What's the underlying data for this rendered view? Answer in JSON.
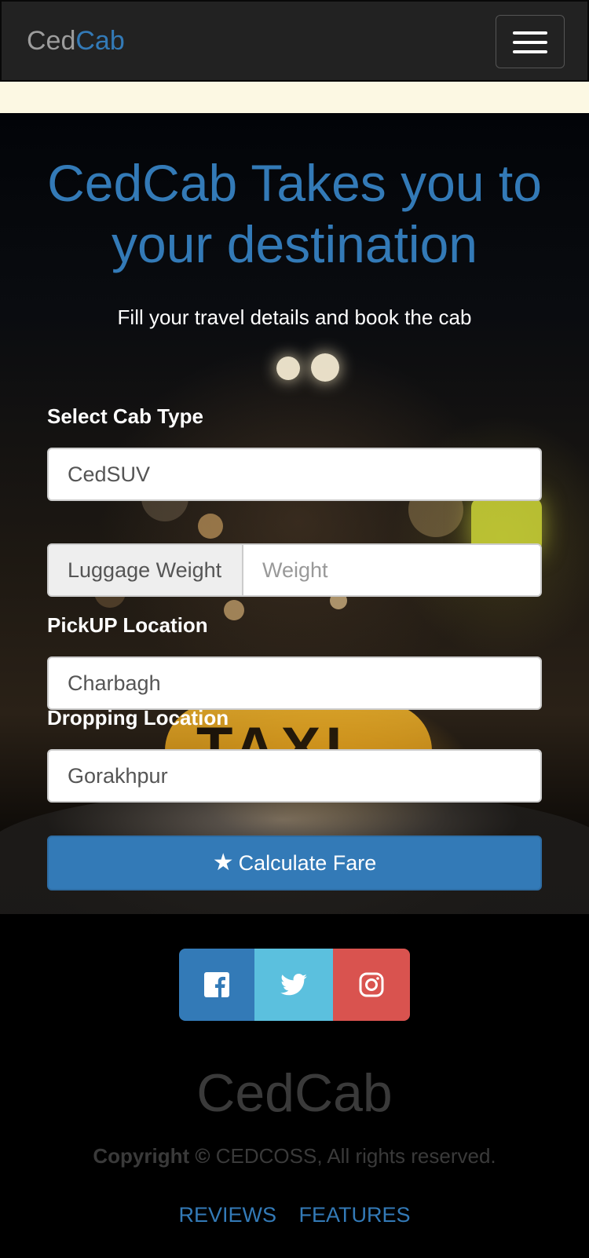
{
  "navbar": {
    "brand_part1": "Ced",
    "brand_part2": "Cab",
    "toggle_icon": "hamburger-menu-icon"
  },
  "hero": {
    "title": "CedCab Takes you to your destination",
    "subtitle": "Fill your travel details and book the cab",
    "sign_text": "TAXI"
  },
  "form": {
    "cab_type_label": "Select Cab Type",
    "cab_type_value": "CedSUV",
    "luggage_addon": "Luggage Weight",
    "luggage_placeholder": "Weight",
    "pickup_label": "PickUP Location",
    "pickup_value": "Charbagh",
    "drop_label": "Dropping Location",
    "drop_value": "Gorakhpur",
    "submit_label": "Calculate Fare",
    "submit_icon": "star-icon"
  },
  "social": {
    "facebook_icon": "facebook-icon",
    "twitter_icon": "twitter-icon",
    "instagram_icon": "instagram-icon",
    "colors": {
      "facebook": "#337ab7",
      "twitter": "#5bc0de",
      "instagram": "#d9534f"
    }
  },
  "footer": {
    "title": "CedCab",
    "copyright_bold": "Copyright ©",
    "copyright_text": " CEDCOSS, All rights reserved.",
    "links": [
      "REVIEWS",
      "FEATURES"
    ]
  },
  "colors": {
    "accent": "#337ab7",
    "navbar_bg": "#222222",
    "alert_strip": "#fcf8e3"
  }
}
